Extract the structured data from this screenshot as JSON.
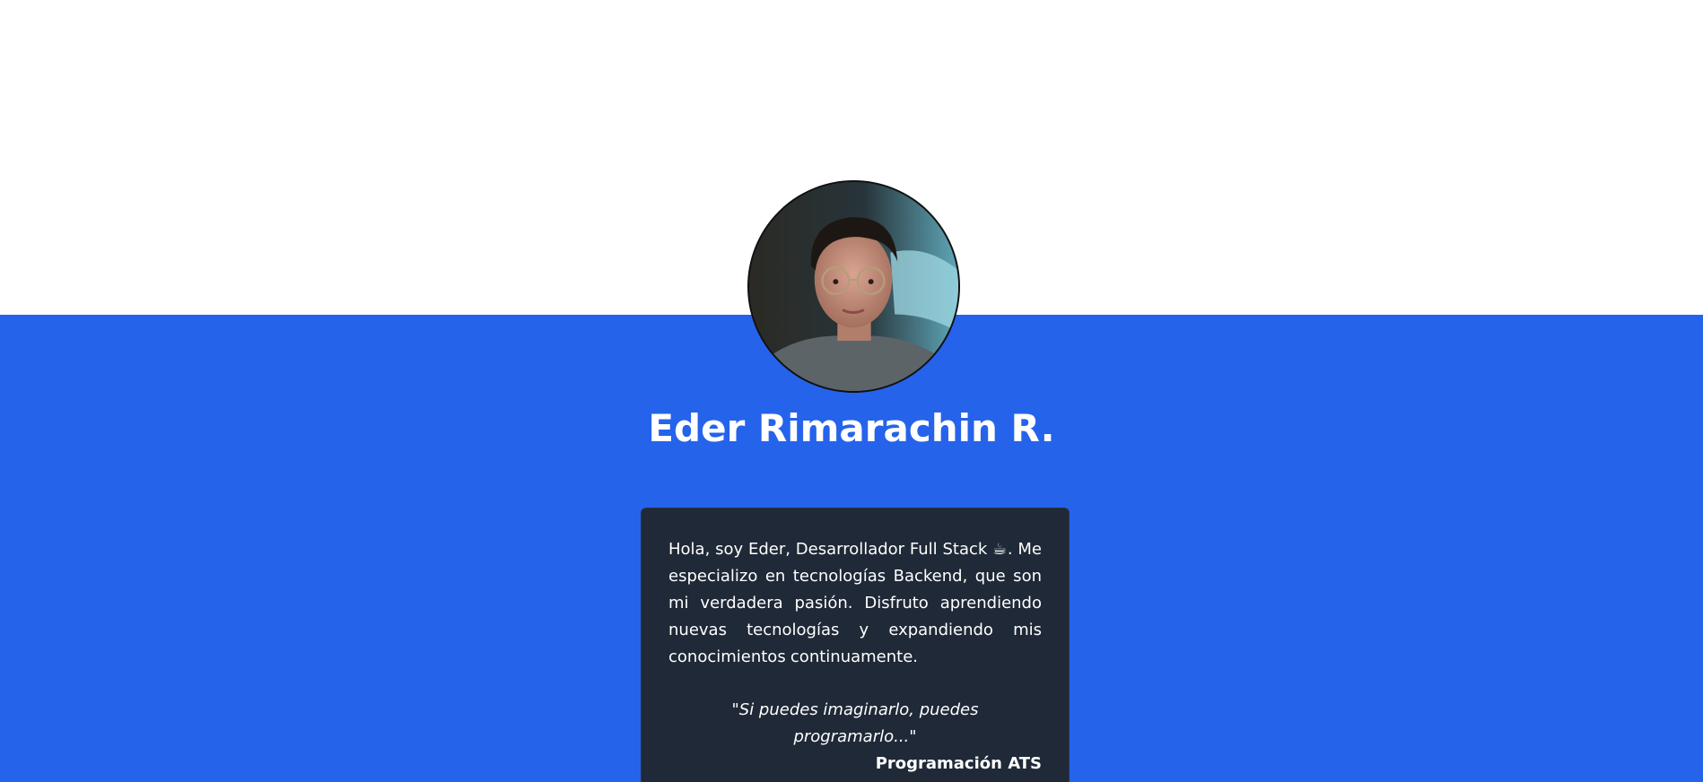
{
  "profile": {
    "name": "Eder Rimarachin R.",
    "bio": "Hola, soy Eder, Desarrollador Full Stack ☕. Me especializo en tecnologías Backend, que son mi verdadera pasión. Disfruto aprendiendo nuevas tecnologías y expandiendo mis conocimientos continuamente.",
    "quote": "\"Si puedes imaginarlo, puedes programarlo...\"",
    "quote_author": "Programación ATS",
    "avatar_icon": "profile-photo"
  },
  "colors": {
    "top_background": "#ffffff",
    "band_background": "#2563eb",
    "card_background": "#1f2937",
    "text": "#ffffff"
  }
}
